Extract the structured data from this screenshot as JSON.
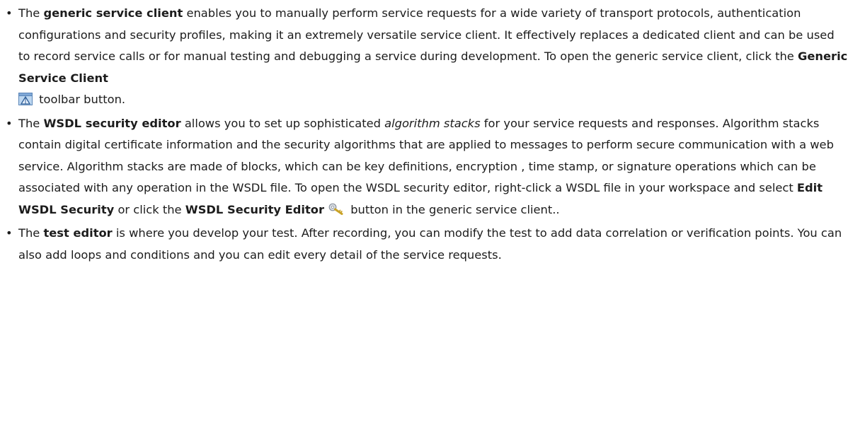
{
  "items": [
    {
      "t1": "The ",
      "term": "generic service client",
      "t2": " enables you to manually perform service requests for a wide variety of transport protocols, authentication configurations and security profiles, making it an extremely versatile service client. It effectively replaces a dedicated client and can be used to record service calls or for manual testing and debugging a service during development. To open the generic service client, click the ",
      "ui_label": "Generic Service Client",
      "icon": "generic-service-client-icon",
      "t3": " toolbar button."
    },
    {
      "t1": "The ",
      "term": "WSDL security editor",
      "t2": " allows you to set up sophisticated ",
      "emph": "algorithm stacks",
      "t3": " for your service requests and responses. Algorithm stacks contain digital certificate information and the security algorithms that are applied to messages to perform secure communication with a web service. Algorithm stacks are made of blocks, which can be key definitions, encryption , time stamp, or signature operations which can be associated with any operation in the WSDL file. To open the WSDL security editor, right-click a WSDL file in your workspace and select ",
      "ui_label1": "Edit WSDL Security",
      "t4": " or click the ",
      "ui_label2": "WSDL Security Editor",
      "icon": "key-icon",
      "t5": " button in the generic service client.."
    },
    {
      "t1": "The ",
      "term": "test editor",
      "t2": " is where you develop your test. After recording, you can modify the test to add data correlation or verification points. You can also add loops and conditions and you can edit every detail of the service requests."
    }
  ]
}
